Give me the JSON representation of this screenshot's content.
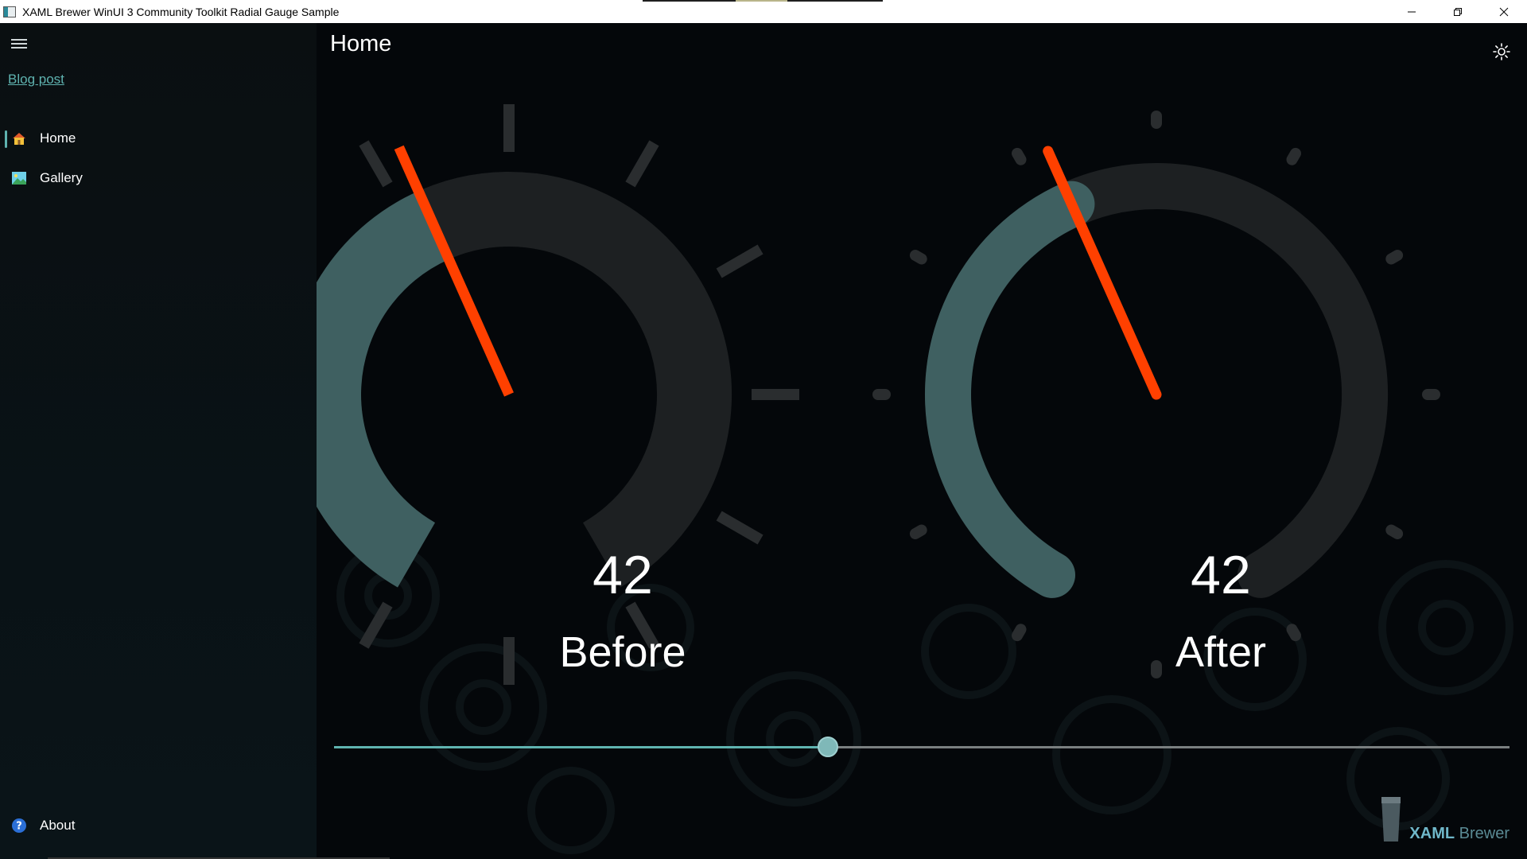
{
  "window": {
    "title": "XAML Brewer WinUI 3 Community Toolkit Radial Gauge Sample"
  },
  "nav": {
    "blog_link": "Blog post",
    "items": [
      {
        "label": "Home",
        "icon": "home-icon",
        "selected": true
      },
      {
        "label": "Gallery",
        "icon": "gallery-icon",
        "selected": false
      }
    ],
    "footer": {
      "label": "About",
      "icon": "help-icon"
    }
  },
  "page": {
    "title": "Home"
  },
  "gauges": [
    {
      "value": "42",
      "label": "Before"
    },
    {
      "value": "42",
      "label": "After"
    }
  ],
  "slider": {
    "value": 42,
    "min": 0,
    "max": 100
  },
  "brand": {
    "strong": "XAML",
    "rest": " Brewer"
  },
  "colors": {
    "accent": "#5fb3b0",
    "gauge_trail": "#3f6061",
    "gauge_scale": "#1d2022",
    "needle": "#ff4000",
    "tick": "#2a2d2f"
  }
}
